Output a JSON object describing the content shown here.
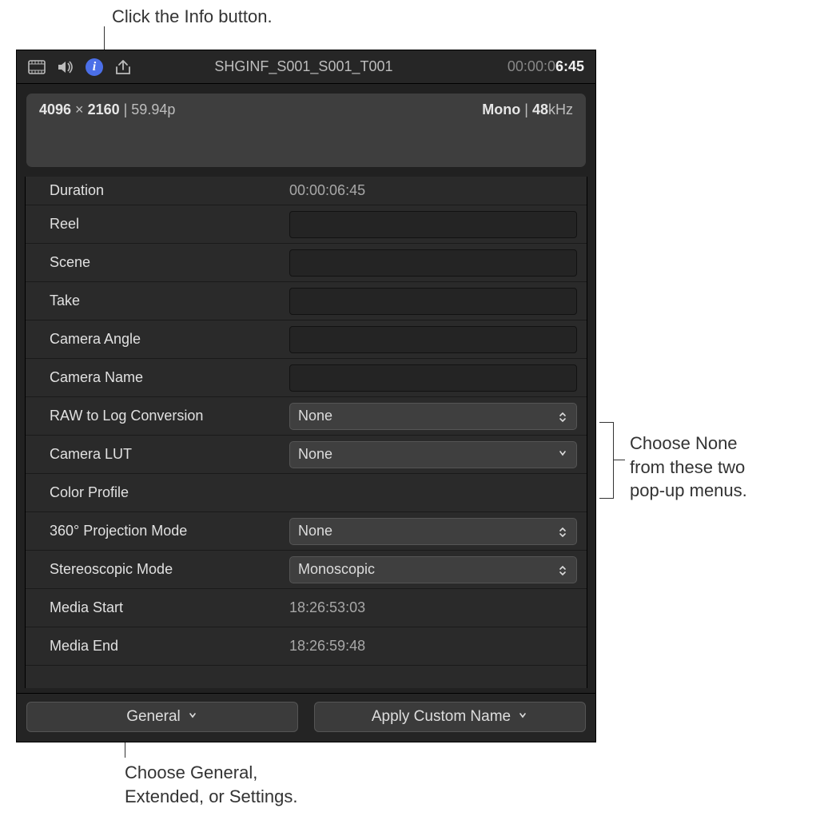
{
  "callouts": {
    "top": "Click the Info button.",
    "right_l1": "Choose None",
    "right_l2": "from these two",
    "right_l3": "pop-up menus.",
    "bottom_l1": "Choose General,",
    "bottom_l2": "Extended, or Settings."
  },
  "toolbar": {
    "clip_name": "SHGINF_S001_S001_T001",
    "timecode_dim": "00:00:0",
    "timecode_bright": "6:45"
  },
  "summary": {
    "res_w": "4096",
    "res_x": " × ",
    "res_h": "2160",
    "res_sep": " | ",
    "fps": "59.94p",
    "audio_mode": "Mono",
    "audio_sep": " | ",
    "audio_rate_num": "48",
    "audio_rate_unit": "kHz"
  },
  "rows": {
    "duration_label": "Duration",
    "duration_value": "00:00:06:45",
    "reel_label": "Reel",
    "scene_label": "Scene",
    "take_label": "Take",
    "camera_angle_label": "Camera Angle",
    "camera_name_label": "Camera Name",
    "raw_log_label": "RAW to Log Conversion",
    "raw_log_value": "None",
    "camera_lut_label": "Camera LUT",
    "camera_lut_value": "None",
    "color_profile_label": "Color Profile",
    "projection_label": "360° Projection Mode",
    "projection_value": "None",
    "stereo_label": "Stereoscopic Mode",
    "stereo_value": "Monoscopic",
    "media_start_label": "Media Start",
    "media_start_value": "18:26:53:03",
    "media_end_label": "Media End",
    "media_end_value": "18:26:59:48"
  },
  "footer": {
    "view_menu": "General",
    "action_menu": "Apply Custom Name"
  }
}
